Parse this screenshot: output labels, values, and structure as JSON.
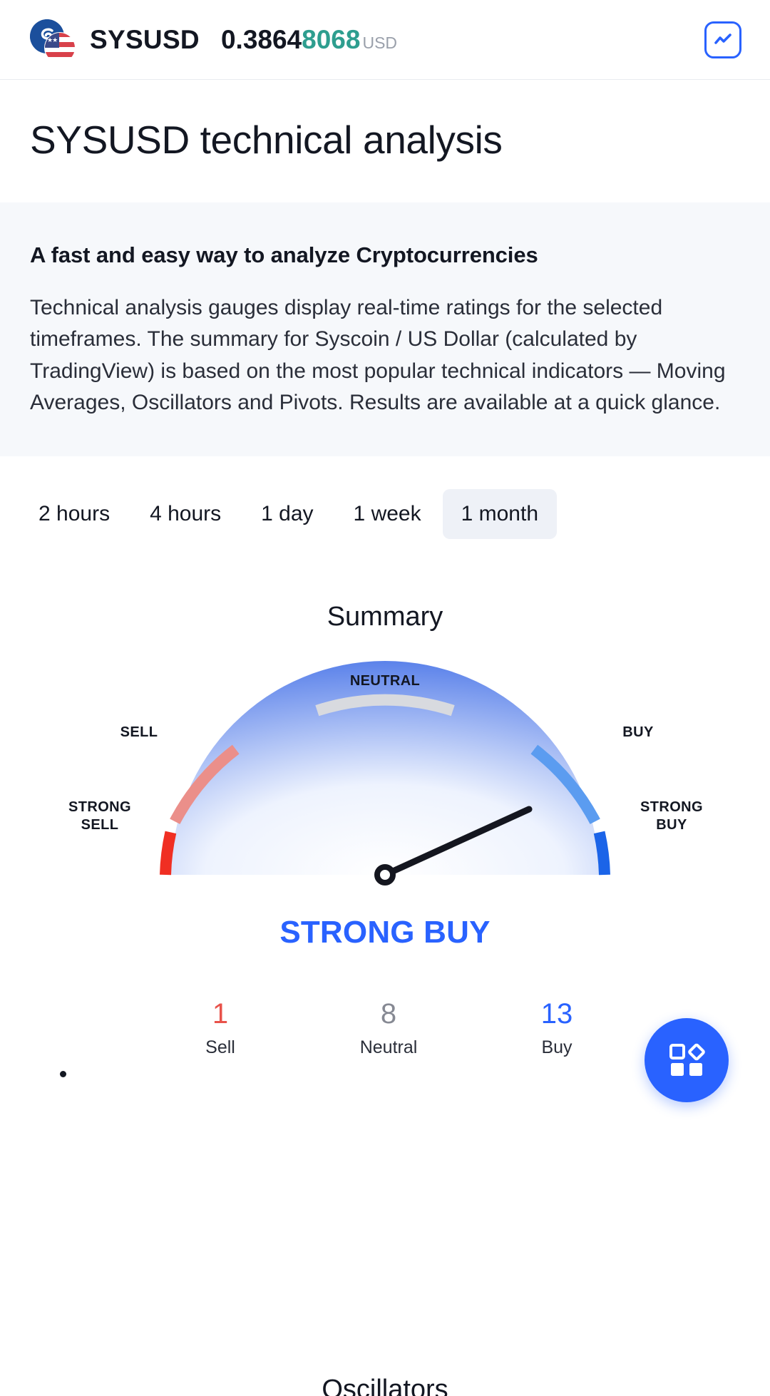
{
  "header": {
    "symbol": "SYSUSD",
    "price_main": "0.3864",
    "price_tail": "8068",
    "currency": "USD",
    "logo_icon": "syscoin-usflag-logo",
    "chart_button_icon": "chart-line-icon"
  },
  "page": {
    "title": "SYSUSD technical analysis"
  },
  "info": {
    "heading": "A fast and easy way to analyze Cryptocurrencies",
    "body": "Technical analysis gauges display real-time ratings for the selected timeframes. The summary for Syscoin / US Dollar (calculated by TradingView) is based on the most popular technical indicators — Moving Averages, Oscillators and Pivots. Results are available at a quick glance."
  },
  "timeframes": {
    "items": [
      {
        "label": "2 hours",
        "active": false
      },
      {
        "label": "4 hours",
        "active": false
      },
      {
        "label": "1 day",
        "active": false
      },
      {
        "label": "1 week",
        "active": false
      },
      {
        "label": "1 month",
        "active": true
      }
    ]
  },
  "summary": {
    "title": "Summary",
    "verdict": "STRONG BUY",
    "gauge_labels": {
      "strong_sell": "STRONG\nSELL",
      "strong_sell_line1": "STRONG",
      "strong_sell_line2": "SELL",
      "sell": "SELL",
      "neutral": "NEUTRAL",
      "buy": "BUY",
      "strong_buy_line1": "STRONG",
      "strong_buy_line2": "BUY"
    },
    "counts": [
      {
        "value": "1",
        "label": "Sell",
        "tone": "sell"
      },
      {
        "value": "8",
        "label": "Neutral",
        "tone": "neutral"
      },
      {
        "value": "13",
        "label": "Buy",
        "tone": "buy"
      }
    ]
  },
  "next_section": {
    "heading": "Oscillators"
  },
  "fab": {
    "icon": "widgets-grid-icon"
  },
  "colors": {
    "accent_blue": "#2962ff",
    "price_teal": "#2e9e8f",
    "strong_sell": "#f02f23",
    "sell": "#eb8f8a",
    "neutral": "#d8dadf",
    "buy": "#5b9cf0",
    "strong_buy": "#1b64e8",
    "panel_bg": "#f6f8fb"
  },
  "chart_data": {
    "type": "gauge",
    "title": "Summary",
    "value_label": "STRONG BUY",
    "needle_angle_deg": 25,
    "segments": [
      {
        "name": "STRONG SELL",
        "color": "#f02f23"
      },
      {
        "name": "SELL",
        "color": "#eb8f8a"
      },
      {
        "name": "NEUTRAL",
        "color": "#d8dadf"
      },
      {
        "name": "BUY",
        "color": "#5b9cf0"
      },
      {
        "name": "STRONG BUY",
        "color": "#1b64e8"
      }
    ],
    "counts": {
      "Sell": 1,
      "Neutral": 8,
      "Buy": 13
    }
  }
}
